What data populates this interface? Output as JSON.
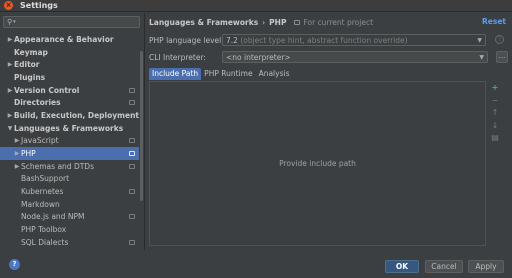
{
  "window": {
    "title": "Settings"
  },
  "search": {
    "value": ""
  },
  "tree": [
    {
      "label": "Appearance & Behavior",
      "level": 0,
      "arrow": "▶",
      "bold": true,
      "project": false,
      "selected": false
    },
    {
      "label": "Keymap",
      "level": 0,
      "arrow": "",
      "bold": true,
      "project": false,
      "selected": false
    },
    {
      "label": "Editor",
      "level": 0,
      "arrow": "▶",
      "bold": true,
      "project": false,
      "selected": false
    },
    {
      "label": "Plugins",
      "level": 0,
      "arrow": "",
      "bold": true,
      "project": false,
      "selected": false
    },
    {
      "label": "Version Control",
      "level": 0,
      "arrow": "▶",
      "bold": true,
      "project": true,
      "selected": false
    },
    {
      "label": "Directories",
      "level": 0,
      "arrow": "",
      "bold": true,
      "project": true,
      "selected": false
    },
    {
      "label": "Build, Execution, Deployment",
      "level": 0,
      "arrow": "▶",
      "bold": true,
      "project": false,
      "selected": false
    },
    {
      "label": "Languages & Frameworks",
      "level": 0,
      "arrow": "▼",
      "bold": true,
      "project": false,
      "selected": false
    },
    {
      "label": "JavaScript",
      "level": 1,
      "arrow": "▶",
      "bold": false,
      "project": true,
      "selected": false
    },
    {
      "label": "PHP",
      "level": 1,
      "arrow": "▶",
      "bold": false,
      "project": true,
      "selected": true
    },
    {
      "label": "Schemas and DTDs",
      "level": 1,
      "arrow": "▶",
      "bold": false,
      "project": true,
      "selected": false
    },
    {
      "label": "BashSupport",
      "level": 1,
      "arrow": "",
      "bold": false,
      "project": false,
      "selected": false
    },
    {
      "label": "Kubernetes",
      "level": 1,
      "arrow": "",
      "bold": false,
      "project": true,
      "selected": false
    },
    {
      "label": "Markdown",
      "level": 1,
      "arrow": "",
      "bold": false,
      "project": false,
      "selected": false
    },
    {
      "label": "Node.js and NPM",
      "level": 1,
      "arrow": "",
      "bold": false,
      "project": true,
      "selected": false
    },
    {
      "label": "PHP Toolbox",
      "level": 1,
      "arrow": "",
      "bold": false,
      "project": false,
      "selected": false
    },
    {
      "label": "SQL Dialects",
      "level": 1,
      "arrow": "",
      "bold": false,
      "project": true,
      "selected": false
    }
  ],
  "breadcrumb": {
    "part1": "Languages & Frameworks",
    "separator": "›",
    "part2": "PHP",
    "note": "For current project"
  },
  "reset_label": "Reset",
  "php_level": {
    "label": "PHP language level:",
    "version": "7.2",
    "description": "(object type hint, abstract function override)"
  },
  "cli": {
    "label": "CLI Interpreter:",
    "value": "<no interpreter>",
    "more": "..."
  },
  "tabs": [
    "Include Path",
    "PHP Runtime",
    "Analysis"
  ],
  "include_path": {
    "empty_text": "Provide include path"
  },
  "side_tools": [
    "+",
    "−",
    "↑",
    "↓",
    "▤"
  ],
  "buttons": {
    "help": "?",
    "ok": "OK",
    "cancel": "Cancel",
    "apply": "Apply"
  }
}
